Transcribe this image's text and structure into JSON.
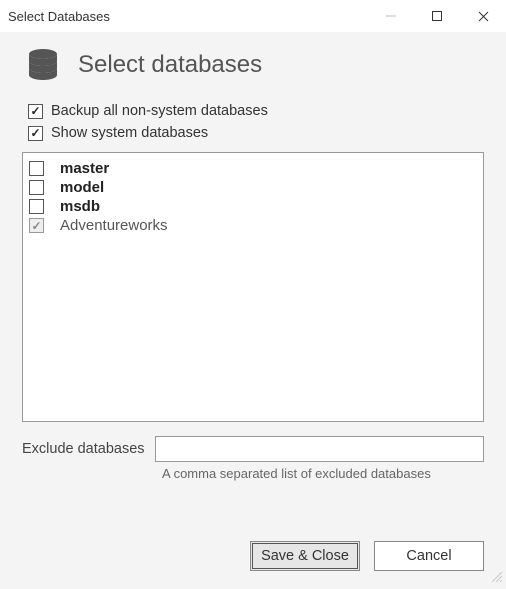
{
  "window": {
    "title": "Select Databases"
  },
  "header": {
    "title": "Select databases",
    "icon": "database-stack-icon"
  },
  "options": {
    "backup_all_label": "Backup all non-system databases",
    "backup_all_checked": true,
    "show_system_label": "Show system databases",
    "show_system_checked": true
  },
  "databases": [
    {
      "name": "master",
      "checked": false,
      "disabled": false
    },
    {
      "name": "model",
      "checked": false,
      "disabled": false
    },
    {
      "name": "msdb",
      "checked": false,
      "disabled": false
    },
    {
      "name": "Adventureworks",
      "checked": true,
      "disabled": true
    }
  ],
  "exclude": {
    "label": "Exclude databases",
    "value": "",
    "hint": "A comma separated list of excluded databases"
  },
  "buttons": {
    "save_close": "Save & Close",
    "cancel": "Cancel"
  }
}
